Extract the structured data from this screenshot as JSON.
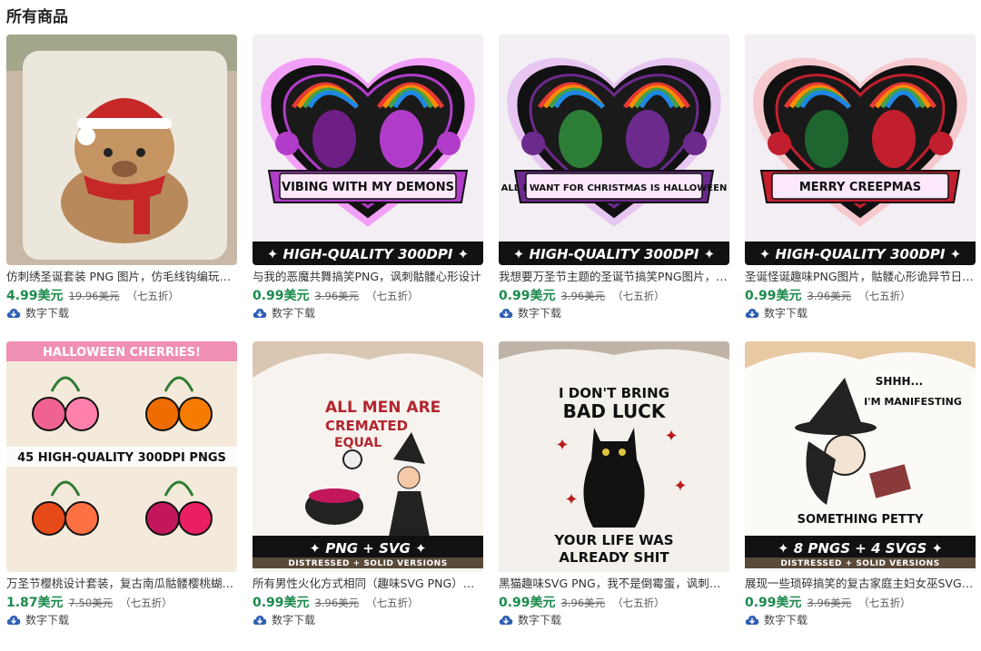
{
  "section_title": "所有商品",
  "download_label": "数字下载",
  "colors": {
    "price": "#1b8a4c",
    "download_icon": "#2f5fb3"
  },
  "products": [
    {
      "title": "仿刺绣圣诞套装 PNG 图片，仿毛线钩编玩偶高地牛圣诞帽",
      "price": "4.99美元",
      "original_price": "19.96美元",
      "discount": "（七五折）",
      "image": {
        "kind": "pillow-cow"
      }
    },
    {
      "title": "与我的恶魔共舞搞笑PNG，讽刺骷髅心形设计",
      "price": "0.99美元",
      "original_price": "3.96美元",
      "discount": "（七五折）",
      "image": {
        "kind": "heart",
        "banner": "VIBING WITH MY DEMONS",
        "badge": "✦ HIGH-QUALITY 300DPI ✦",
        "c1": "#b13cc9",
        "c2": "#7a1f93",
        "c3": "#f2a0f7"
      }
    },
    {
      "title": "我想要万圣节主题的圣诞节搞笑PNG图片，南瓜与骷髅手",
      "price": "0.99美元",
      "original_price": "3.96美元",
      "discount": "（七五折）",
      "image": {
        "kind": "heart",
        "banner": "ALL I WANT FOR CHRISTMAS IS HALLOWEEN",
        "badge": "✦ HIGH-QUALITY 300DPI ✦",
        "c1": "#6c2a8c",
        "c2": "#2f8a3a",
        "c3": "#e8c6f2"
      }
    },
    {
      "title": "圣诞怪诞趣味PNG图片，骷髅心形诡异节日设计",
      "price": "0.99美元",
      "original_price": "3.96美元",
      "discount": "（七五折）",
      "image": {
        "kind": "heart",
        "banner": "MERRY CREEPMAS",
        "badge": "✦ HIGH-QUALITY 300DPI ✦",
        "c1": "#c11f2e",
        "c2": "#1e6f33",
        "c3": "#f5c9cd"
      }
    },
    {
      "title": "万圣节樱桃设计套装，复古南瓜骷髅樱桃蝴蝶结",
      "price": "1.87美元",
      "original_price": "7.50美元",
      "discount": "（七五折）",
      "image": {
        "kind": "cherries",
        "top": "HALLOWEEN CHERRIES!",
        "mid": "45 HIGH-QUALITY 300DPI PNGS"
      }
    },
    {
      "title": "所有男性火化方式相同（趣味SVG PNG）女巫骷髅",
      "price": "0.99美元",
      "original_price": "3.96美元",
      "discount": "（七五折）",
      "image": {
        "kind": "shirt",
        "line1": "ALL MEN ARE",
        "line2": "CREMATED",
        "line3": "EQUAL",
        "badge": "✦ PNG + SVG ✦",
        "sub": "DISTRESSED + SOLID VERSIONS",
        "ink": "#b3262f"
      }
    },
    {
      "title": "黑猫趣味SVG PNG，我不是倒霉蛋，讽刺黑猫设计",
      "price": "0.99美元",
      "original_price": "3.96美元",
      "discount": "（七五折）",
      "image": {
        "kind": "cat",
        "line1": "I DON'T BRING",
        "line2": "BAD LUCK",
        "line3": "YOUR LIFE WAS",
        "line4": "ALREADY SHIT"
      }
    },
    {
      "title": "展现一些琐碎搞笑的复古家庭主妇女巫SVG PNG",
      "price": "0.99美元",
      "original_price": "3.96美元",
      "discount": "（七五折）",
      "image": {
        "kind": "witch",
        "line1": "SHHH...",
        "line2": "I'M MANIFESTING",
        "line3": "SOMETHING PETTY",
        "badge": "✦ 8 PNGS + 4 SVGS ✦",
        "sub": "DISTRESSED + SOLID VERSIONS"
      }
    }
  ]
}
